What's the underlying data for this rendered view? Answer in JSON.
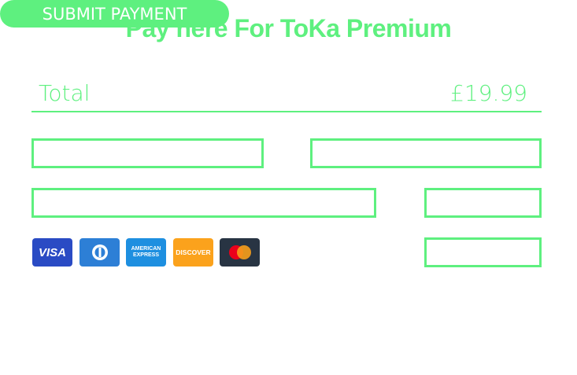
{
  "title": "Pay here For ToKa Premium",
  "total": {
    "label": "Total",
    "amount": "£19.99"
  },
  "cards": [
    {
      "icon": "visa-icon",
      "label": "VISA",
      "color": "#2a4bc4"
    },
    {
      "icon": "diners-club-icon",
      "label": "",
      "color": "#2d7fd6"
    },
    {
      "icon": "american-express-icon",
      "label": "AMERICAN EXPRESS",
      "color": "#1e8fe0"
    },
    {
      "icon": "discover-icon",
      "label": "DISCOVER",
      "color": "#fba21c"
    },
    {
      "icon": "mastercard-icon",
      "label": "",
      "color": "#283443"
    }
  ],
  "submit_label": "SUBMIT PAYMENT",
  "accent": "#5ef07f"
}
